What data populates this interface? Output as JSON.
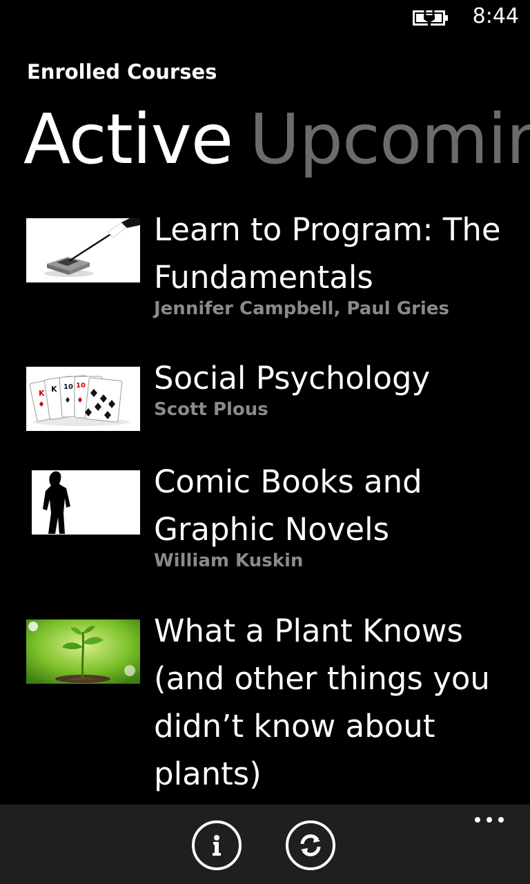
{
  "status_bar": {
    "time": "8:44",
    "battery_icon": "battery-charging-icon"
  },
  "header": {
    "app_title": "Enrolled Courses"
  },
  "pivot": {
    "items": [
      {
        "label": "Active",
        "selected": true
      },
      {
        "label": "Upcoming",
        "selected": false
      }
    ]
  },
  "courses": [
    {
      "title": "Learn to Program: The Fundamentals",
      "instructor": "Jennifer Campbell, Paul Gries",
      "thumbnail": "wand-over-box-image"
    },
    {
      "title": "Social Psychology",
      "instructor": "Scott Plous",
      "thumbnail": "playing-cards-image"
    },
    {
      "title": "Comic Books and Graphic Novels",
      "instructor": "William Kuskin",
      "thumbnail": "silhouette-figure-image"
    },
    {
      "title": "What a Plant Knows (and other things you didn’t know about plants)",
      "instructor": "",
      "thumbnail": "seedling-image"
    }
  ],
  "app_bar": {
    "buttons": [
      {
        "icon": "info-icon"
      },
      {
        "icon": "refresh-icon"
      }
    ],
    "more_icon": "ellipsis-icon"
  },
  "colors": {
    "background": "#000000",
    "app_bar": "#1f1f1f",
    "inactive_pivot": "#6b6b6b",
    "subtext": "#8a8a8a"
  }
}
